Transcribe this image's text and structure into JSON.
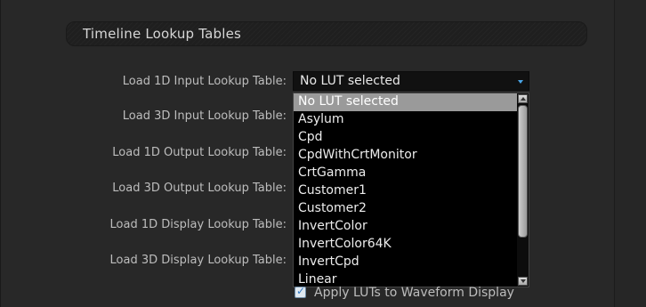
{
  "section": {
    "title": "Timeline Lookup Tables"
  },
  "rows": [
    {
      "label": "Load 1D Input Lookup Table:"
    },
    {
      "label": "Load 3D Input Lookup Table:"
    },
    {
      "label": "Load 1D Output Lookup Table:"
    },
    {
      "label": "Load 3D Output Lookup Table:"
    },
    {
      "label": "Load 1D Display Lookup Table:"
    },
    {
      "label": "Load 3D Display Lookup Table:"
    }
  ],
  "lut_select": {
    "value": "No LUT selected",
    "options": [
      "No LUT selected",
      "Asylum",
      "Cpd",
      "CpdWithCrtMonitor",
      "CrtGamma",
      "Customer1",
      "Customer2",
      "InvertColor",
      "InvertColor64K",
      "InvertCpd",
      "Linear"
    ],
    "selected_index": 0
  },
  "checkbox": {
    "label": "Apply LUTs to Waveform Display",
    "checked": true
  },
  "colors": {
    "accent": "#4aa6e8",
    "highlight": "#9a9a9a",
    "background": "#282828"
  }
}
